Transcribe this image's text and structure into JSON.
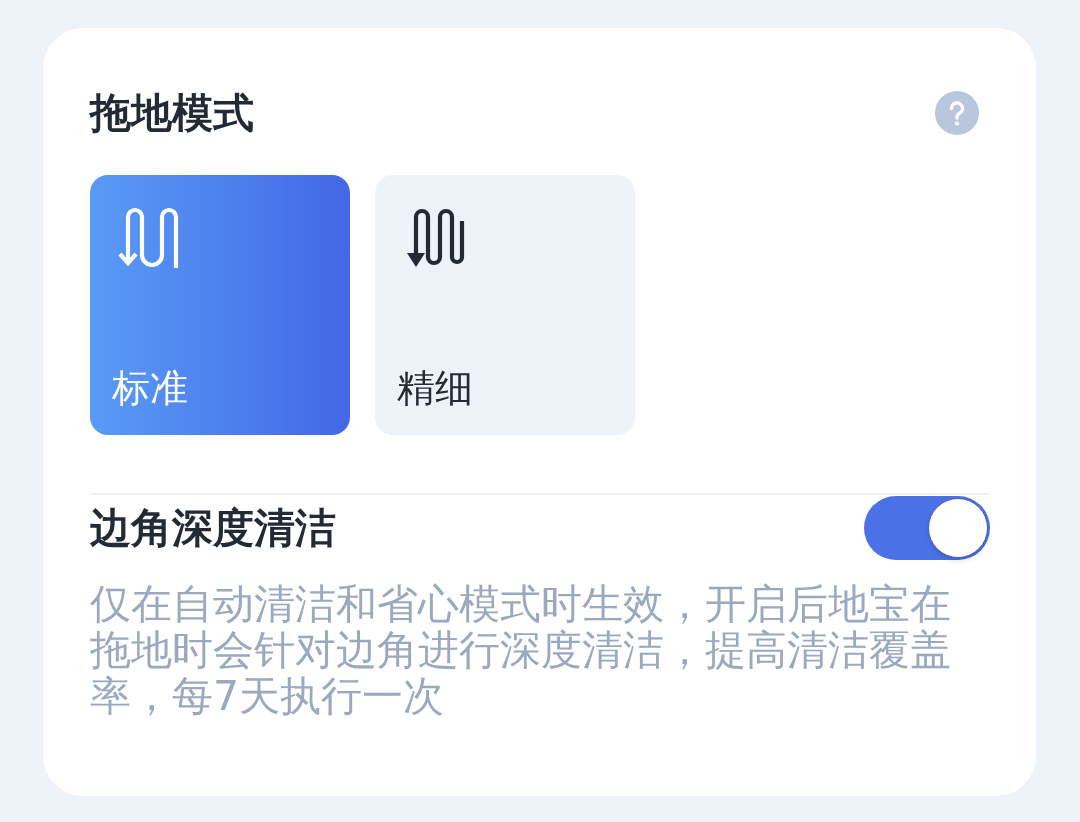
{
  "title": "拖地模式",
  "modes": [
    {
      "kind": "standard",
      "label": "标准",
      "selected": true
    },
    {
      "kind": "fine",
      "label": "精细",
      "selected": false
    }
  ],
  "setting": {
    "label": "边角深度清洁",
    "on": true,
    "description": "仅在自动清洁和省心模式时生效，开启后地宝在拖地时会针对边角进行深度清洁，提高清洁覆盖率，每7天执行一次"
  }
}
